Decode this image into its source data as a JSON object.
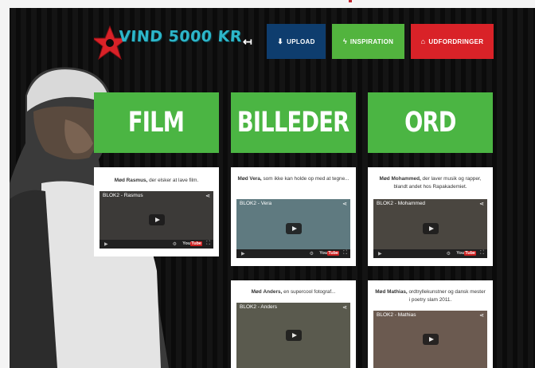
{
  "header": {
    "logo_text": "VIND 5000 KR",
    "back_arrow": "↤",
    "buttons": {
      "upload": {
        "label": "UPLOAD",
        "icon": "download-icon",
        "color": "#0e3d6e"
      },
      "inspiration": {
        "label": "INSPIRATION",
        "icon": "bolt-icon",
        "color": "#52b43e"
      },
      "udfordringer": {
        "label": "UDFORDRINGER",
        "icon": "home-icon",
        "color": "#d92228"
      }
    }
  },
  "categories": [
    {
      "label": "FILM",
      "color": "#4bb543"
    },
    {
      "label": "BILLEDER",
      "color": "#4bb543"
    },
    {
      "label": "ORD",
      "color": "#4bb543"
    }
  ],
  "cards": {
    "rasmus": {
      "intro": "Mød",
      "name": "Rasmus,",
      "desc": "der elsker at lave film.",
      "video_title": "BLOK2 - Rasmus"
    },
    "vera": {
      "intro": "Mød",
      "name": "Vera,",
      "desc": "som ikke kan holde op med at tegne...",
      "video_title": "BLOK2 - Vera"
    },
    "mohammed": {
      "intro": "Mød",
      "name": "Mohammed,",
      "desc": "der laver musik og rapper, blandt andet hos Rapakademiet.",
      "video_title": "BLOK2 - Mohammed"
    },
    "anders": {
      "intro": "Mød",
      "name": "Anders,",
      "desc": "en supercool fotograf...",
      "video_title": "BLOK2 - Anders"
    },
    "mathias": {
      "intro": "Mød",
      "name": "Mathias,",
      "desc": "ordtryllekunstner og dansk mester i poetry slam 2011.",
      "video_title": "BLOK2 - Mathias"
    }
  },
  "player": {
    "youtube_label": "You",
    "youtube_tube": "Tube"
  }
}
